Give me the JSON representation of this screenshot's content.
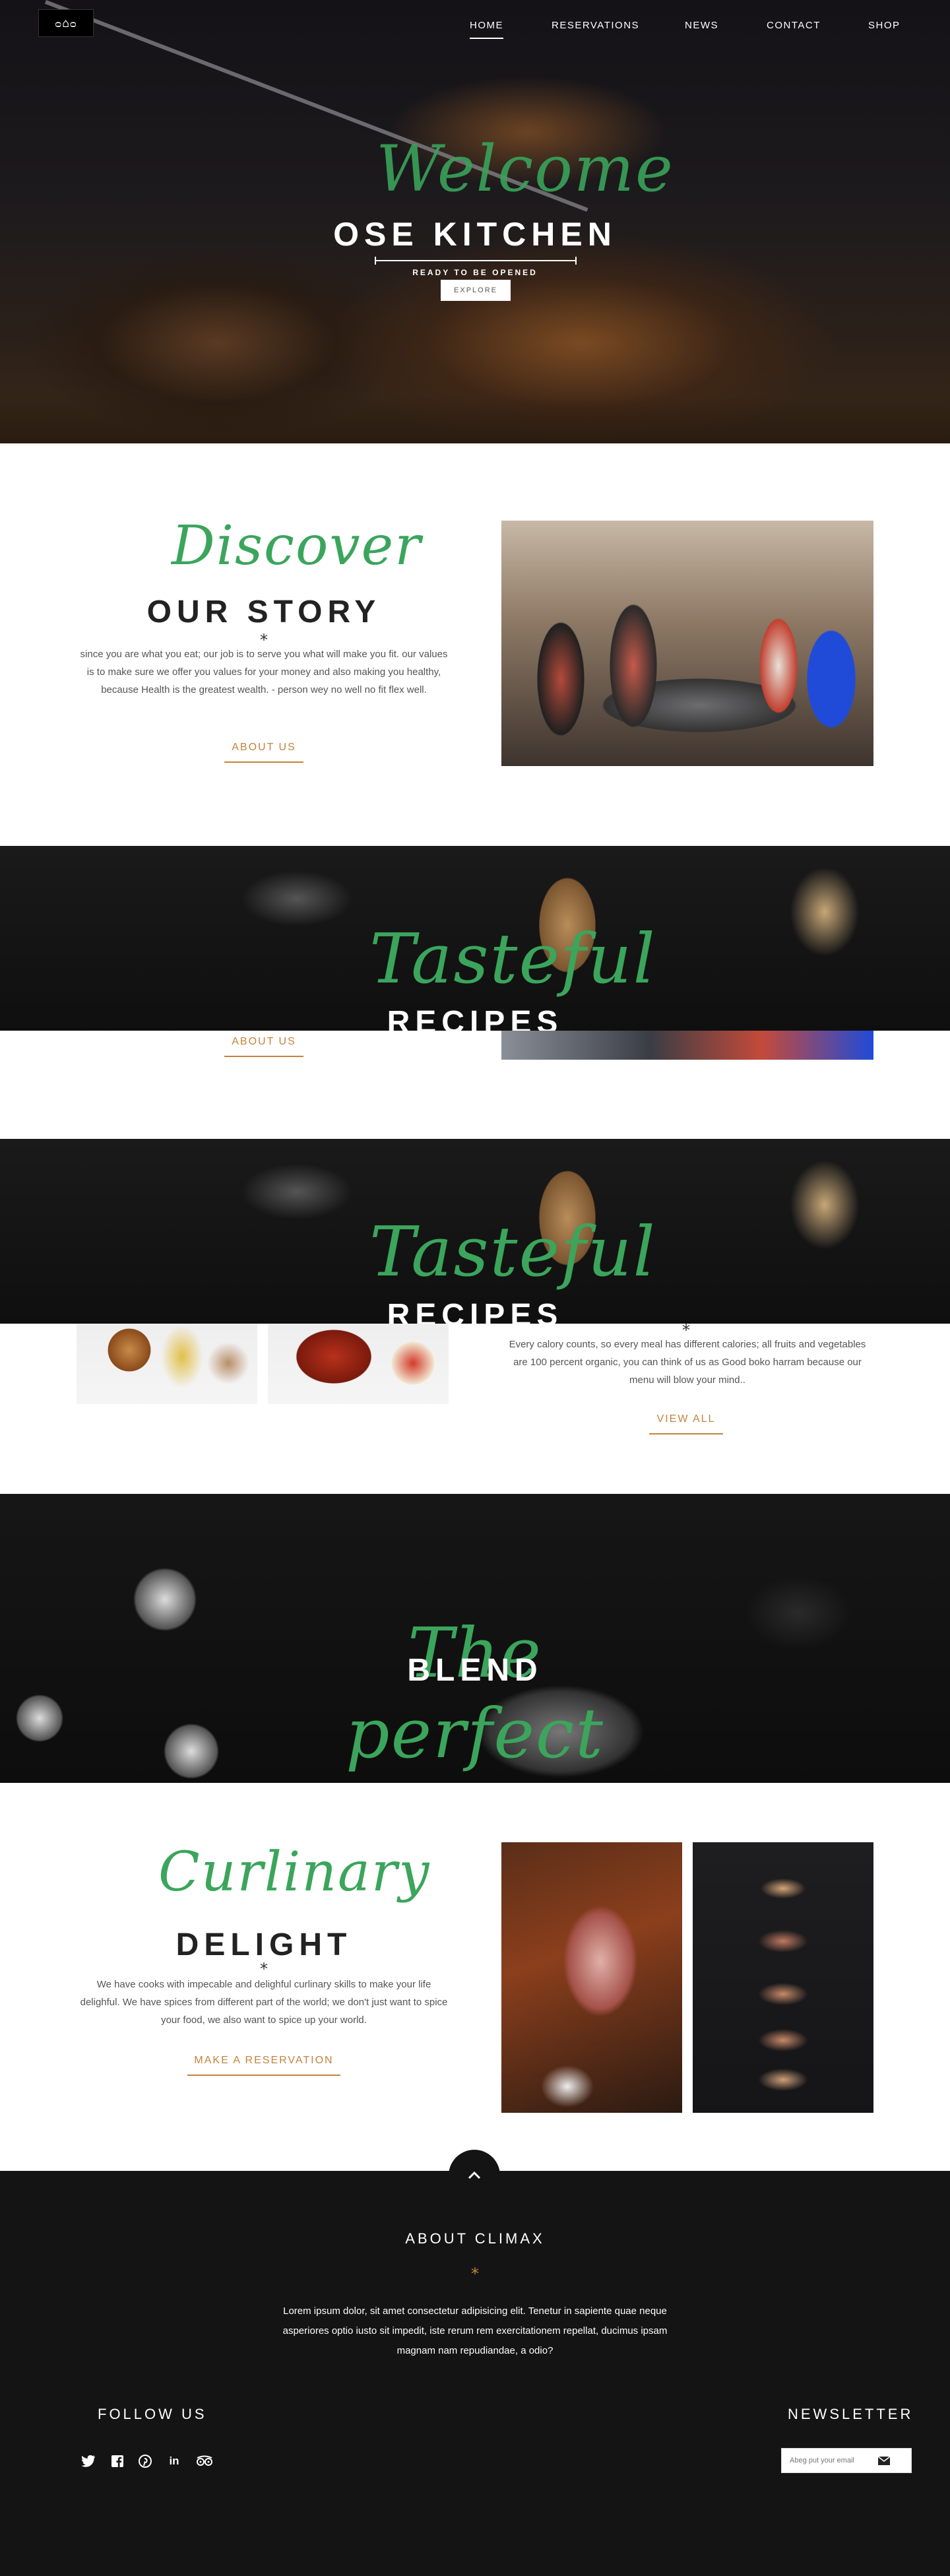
{
  "header": {
    "logo": "ᴑ⌂ᴑ",
    "nav": [
      "HOME",
      "RESERVATIONS",
      "NEWS",
      "CONTACT",
      "SHOP"
    ],
    "active": "HOME",
    "hero_script": "Welcome",
    "hero_title": "OSE KITCHEN",
    "hero_subtitle": "READY TO BE OPENED",
    "hero_button": "EXPLORE"
  },
  "story": {
    "script": "Discover",
    "heading": "OUR STORY",
    "star": "*",
    "text": "since you are what you eat; our job is to serve you what will make you fit. our values is to make sure we offer you values for your money and also making you healthy, because Health is the greatest wealth. - person wey no well no fit flex well.",
    "button": "ABOUT US"
  },
  "recipes_banner_1": {
    "script": "Tasteful",
    "title": "RECIPES",
    "button": "ABOUT US"
  },
  "recipes_banner_2": {
    "script": "Tasteful",
    "title": "RECIPES"
  },
  "recipes": {
    "star": "*",
    "text": "Every calory counts, so every meal has different calories; all fruits and vegetables are 100 percent organic, you can think of us as Good boko harram because our menu will blow your mind..",
    "button": "VIEW ALL"
  },
  "blend": {
    "script": "The perfect",
    "title": "BLEND"
  },
  "delight": {
    "script": "Curlinary",
    "heading": "DELIGHT",
    "star": "*",
    "text": "We have cooks with impecable and delighful curlinary skills to make your life delighful. We have spices from different part of the world; we don't just want to spice your food, we also want to spice up your world.",
    "button": "MAKE A RESERVATION"
  },
  "footer": {
    "about_heading": "ABOUT CLIMAX",
    "star": "*",
    "about_text": "Lorem ipsum dolor, sit amet consectetur adipisicing elit. Tenetur in sapiente quae neque asperiores optio iusto sit impedit, iste rerum rem exercitationem repellat, ducimus ipsam magnam nam repudiandae, a odio?",
    "follow_heading": "FOLLOW US",
    "social": [
      "twitter-icon",
      "facebook-icon",
      "pinterest-icon",
      "linkedin-icon",
      "tripadvisor-icon"
    ],
    "newsletter_heading": "NEWSLETTER",
    "newsletter_placeholder": "Abeg put your email"
  },
  "colors": {
    "accent_green": "#3ba55c",
    "accent_orange": "#c3833d",
    "dark": "#141414"
  }
}
